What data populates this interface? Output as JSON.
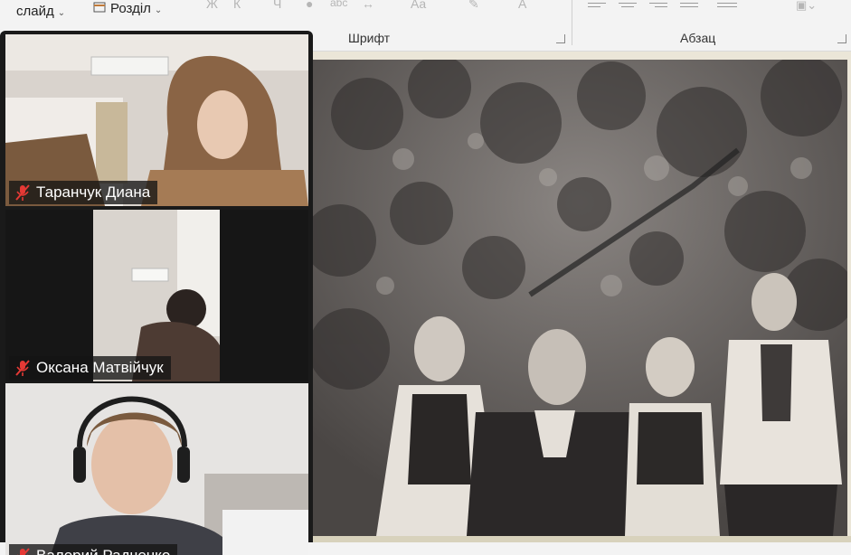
{
  "ribbon": {
    "slide_button": "слайд",
    "section_button": "Розділ",
    "groups": [
      {
        "label": "Шрифт"
      },
      {
        "label": "Абзац"
      }
    ]
  },
  "participants": [
    {
      "name": "Таранчук Диана",
      "muted": true
    },
    {
      "name": "Оксана Матвійчук",
      "muted": true
    },
    {
      "name": "Валерий Радченко",
      "muted": true
    }
  ],
  "icons": {
    "muted_mic": "microphone-muted-icon",
    "muted_color": "#e53935"
  }
}
